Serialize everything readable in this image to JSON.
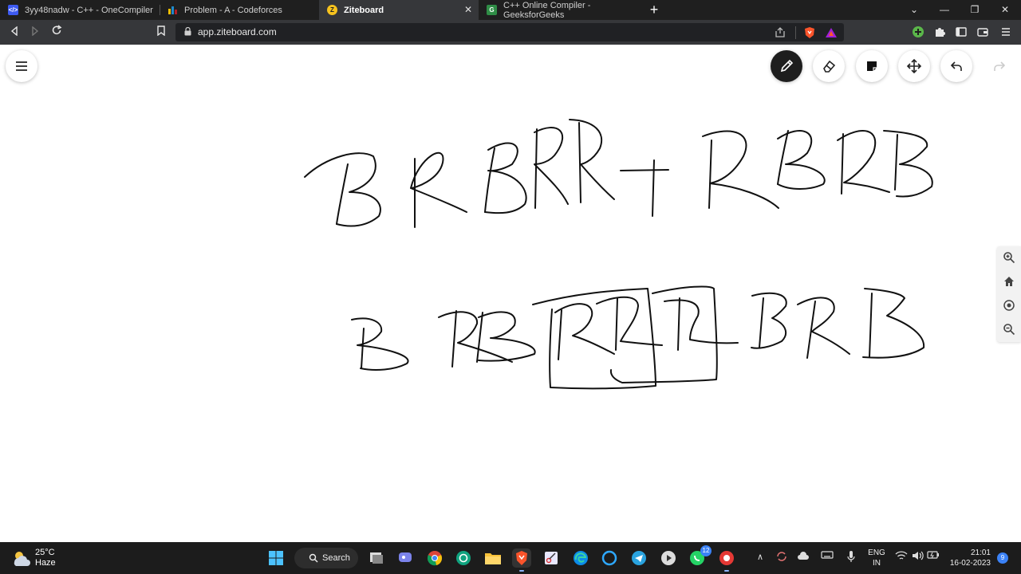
{
  "browser": {
    "tabs": [
      {
        "title": "3yy48nadw - C++ - OneCompiler",
        "icon": "onecompiler-icon",
        "color": "#3d5af1"
      },
      {
        "title": "Problem - A - Codeforces",
        "icon": "codeforces-icon",
        "color": "#1f8acb"
      },
      {
        "title": "Ziteboard",
        "icon": "ziteboard-icon",
        "color": "#f7c31e",
        "active": true
      },
      {
        "title": "C++ Online Compiler - GeeksforGeeks",
        "icon": "geeksforgeeks-icon",
        "color": "#2f8d46"
      }
    ],
    "url": "app.ziteboard.com"
  },
  "toolbar": {
    "tools": [
      "pencil",
      "eraser",
      "sticky-note",
      "move",
      "undo",
      "redo"
    ],
    "active_tool": "pencil"
  },
  "zoom_controls": [
    "zoom-in",
    "home",
    "center",
    "zoom-out"
  ],
  "taskbar": {
    "weather": {
      "temp": "25°C",
      "condition": "Haze"
    },
    "search_label": "Search",
    "whatsapp_badge": "12",
    "language": {
      "line1": "ENG",
      "line2": "IN"
    },
    "clock": {
      "time": "21:01",
      "date": "16-02-2023"
    },
    "notifications": "9"
  }
}
